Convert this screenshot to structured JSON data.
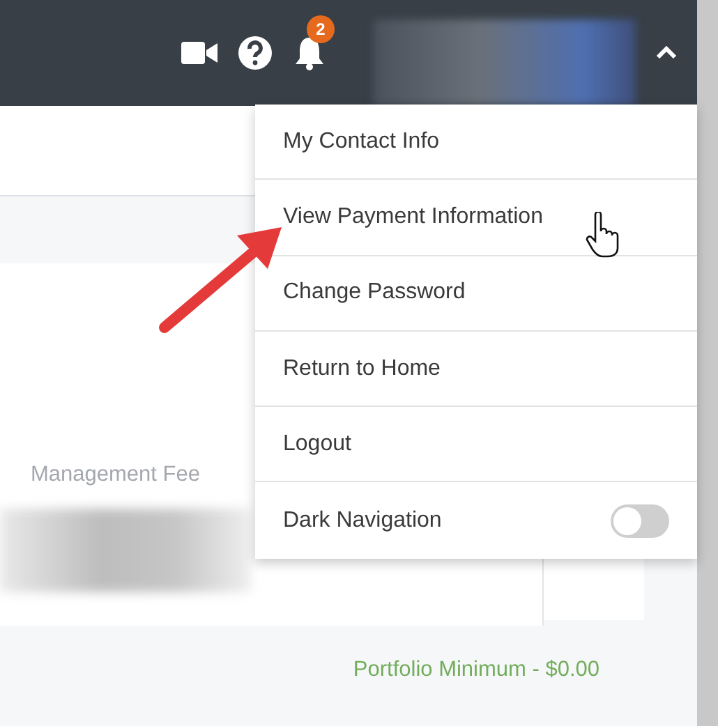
{
  "header": {
    "notification_count": "2",
    "menu_expanded": true
  },
  "menu": [
    {
      "label": "My Contact Info",
      "kind": "link"
    },
    {
      "label": "View Payment Information",
      "kind": "link"
    },
    {
      "label": "Change Password",
      "kind": "link"
    },
    {
      "label": "Return to Home",
      "kind": "link"
    },
    {
      "label": "Logout",
      "kind": "link"
    },
    {
      "label": "Dark Navigation",
      "kind": "toggle",
      "on": false
    }
  ],
  "content": {
    "field_label": "Management Fee",
    "portfolio_minimum": "Portfolio Minimum - $0.00"
  }
}
